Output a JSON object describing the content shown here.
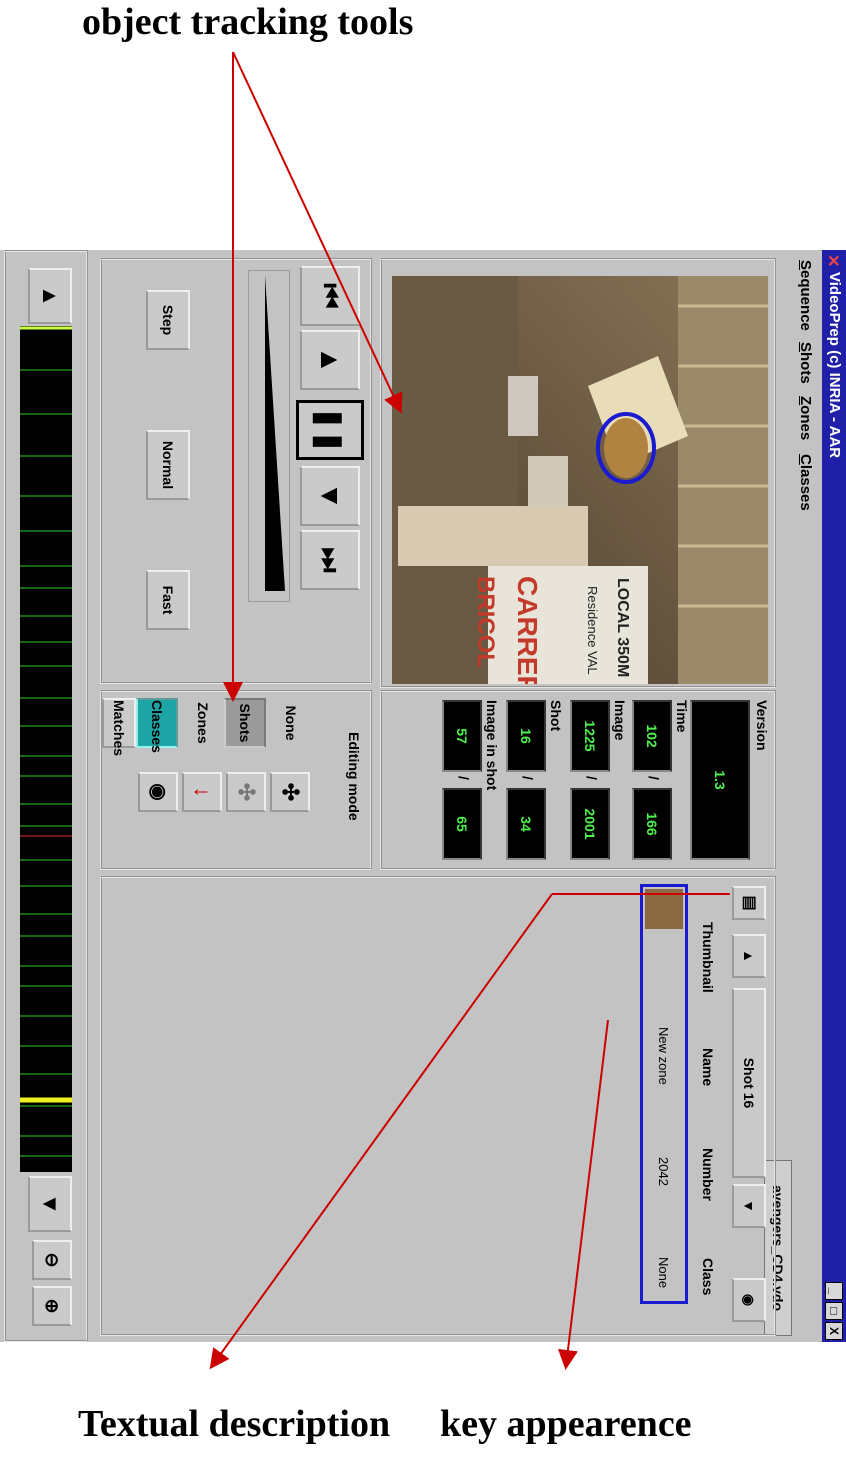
{
  "annotations": {
    "top": "object tracking tools",
    "bottom_left": "Textual description",
    "bottom_right": "key appearence"
  },
  "window": {
    "title": "VideoPrep (c) INRIA - AAR",
    "controls": [
      "_",
      "□",
      "X"
    ]
  },
  "menu": [
    "Sequence",
    "Shots",
    "Zones",
    "Classes"
  ],
  "file": "avengers_CD4.vdo",
  "info": {
    "version_label": "Version",
    "version": "1.3",
    "time_label": "Time",
    "time_cur": "102",
    "time_total": "166",
    "image_label": "Image",
    "image_cur": "1225",
    "image_total": "2001",
    "shot_label": "Shot",
    "shot_cur": "16",
    "shot_total": "34",
    "imginshot_label": "Image in shot",
    "imginshot_cur": "57",
    "imginshot_total": "65",
    "separator": "/"
  },
  "editing": {
    "title": "Editing mode",
    "modes": [
      "None",
      "Shots",
      "Zones",
      "Classes",
      "Matches"
    ],
    "selected": "Classes"
  },
  "speed": {
    "step": "Step",
    "normal": "Normal",
    "fast": "Fast"
  },
  "list": {
    "shot_label": "Shot 16",
    "columns": [
      "Thumbnail",
      "Name",
      "Number",
      "Class"
    ],
    "rows": [
      {
        "name": "New zone",
        "number": "2042",
        "class": "None"
      }
    ]
  },
  "colors": {
    "title_bg": "#1f1fa8",
    "selected_tab": "#1ea5a5",
    "lcd_text": "#4ef04e",
    "annotation_arrow": "#cc0000",
    "zone_outline": "#1a1ad0"
  },
  "icons": [
    "close-icon",
    "maximize-icon",
    "minimize-icon",
    "document-icon",
    "up-arrow-icon",
    "down-arrow-icon",
    "camera-icon",
    "first-frame-icon",
    "play-backward-icon",
    "pause-icon",
    "play-forward-icon",
    "last-frame-icon",
    "puzzle-icon",
    "zoom-in-icon",
    "zoom-out-icon"
  ]
}
